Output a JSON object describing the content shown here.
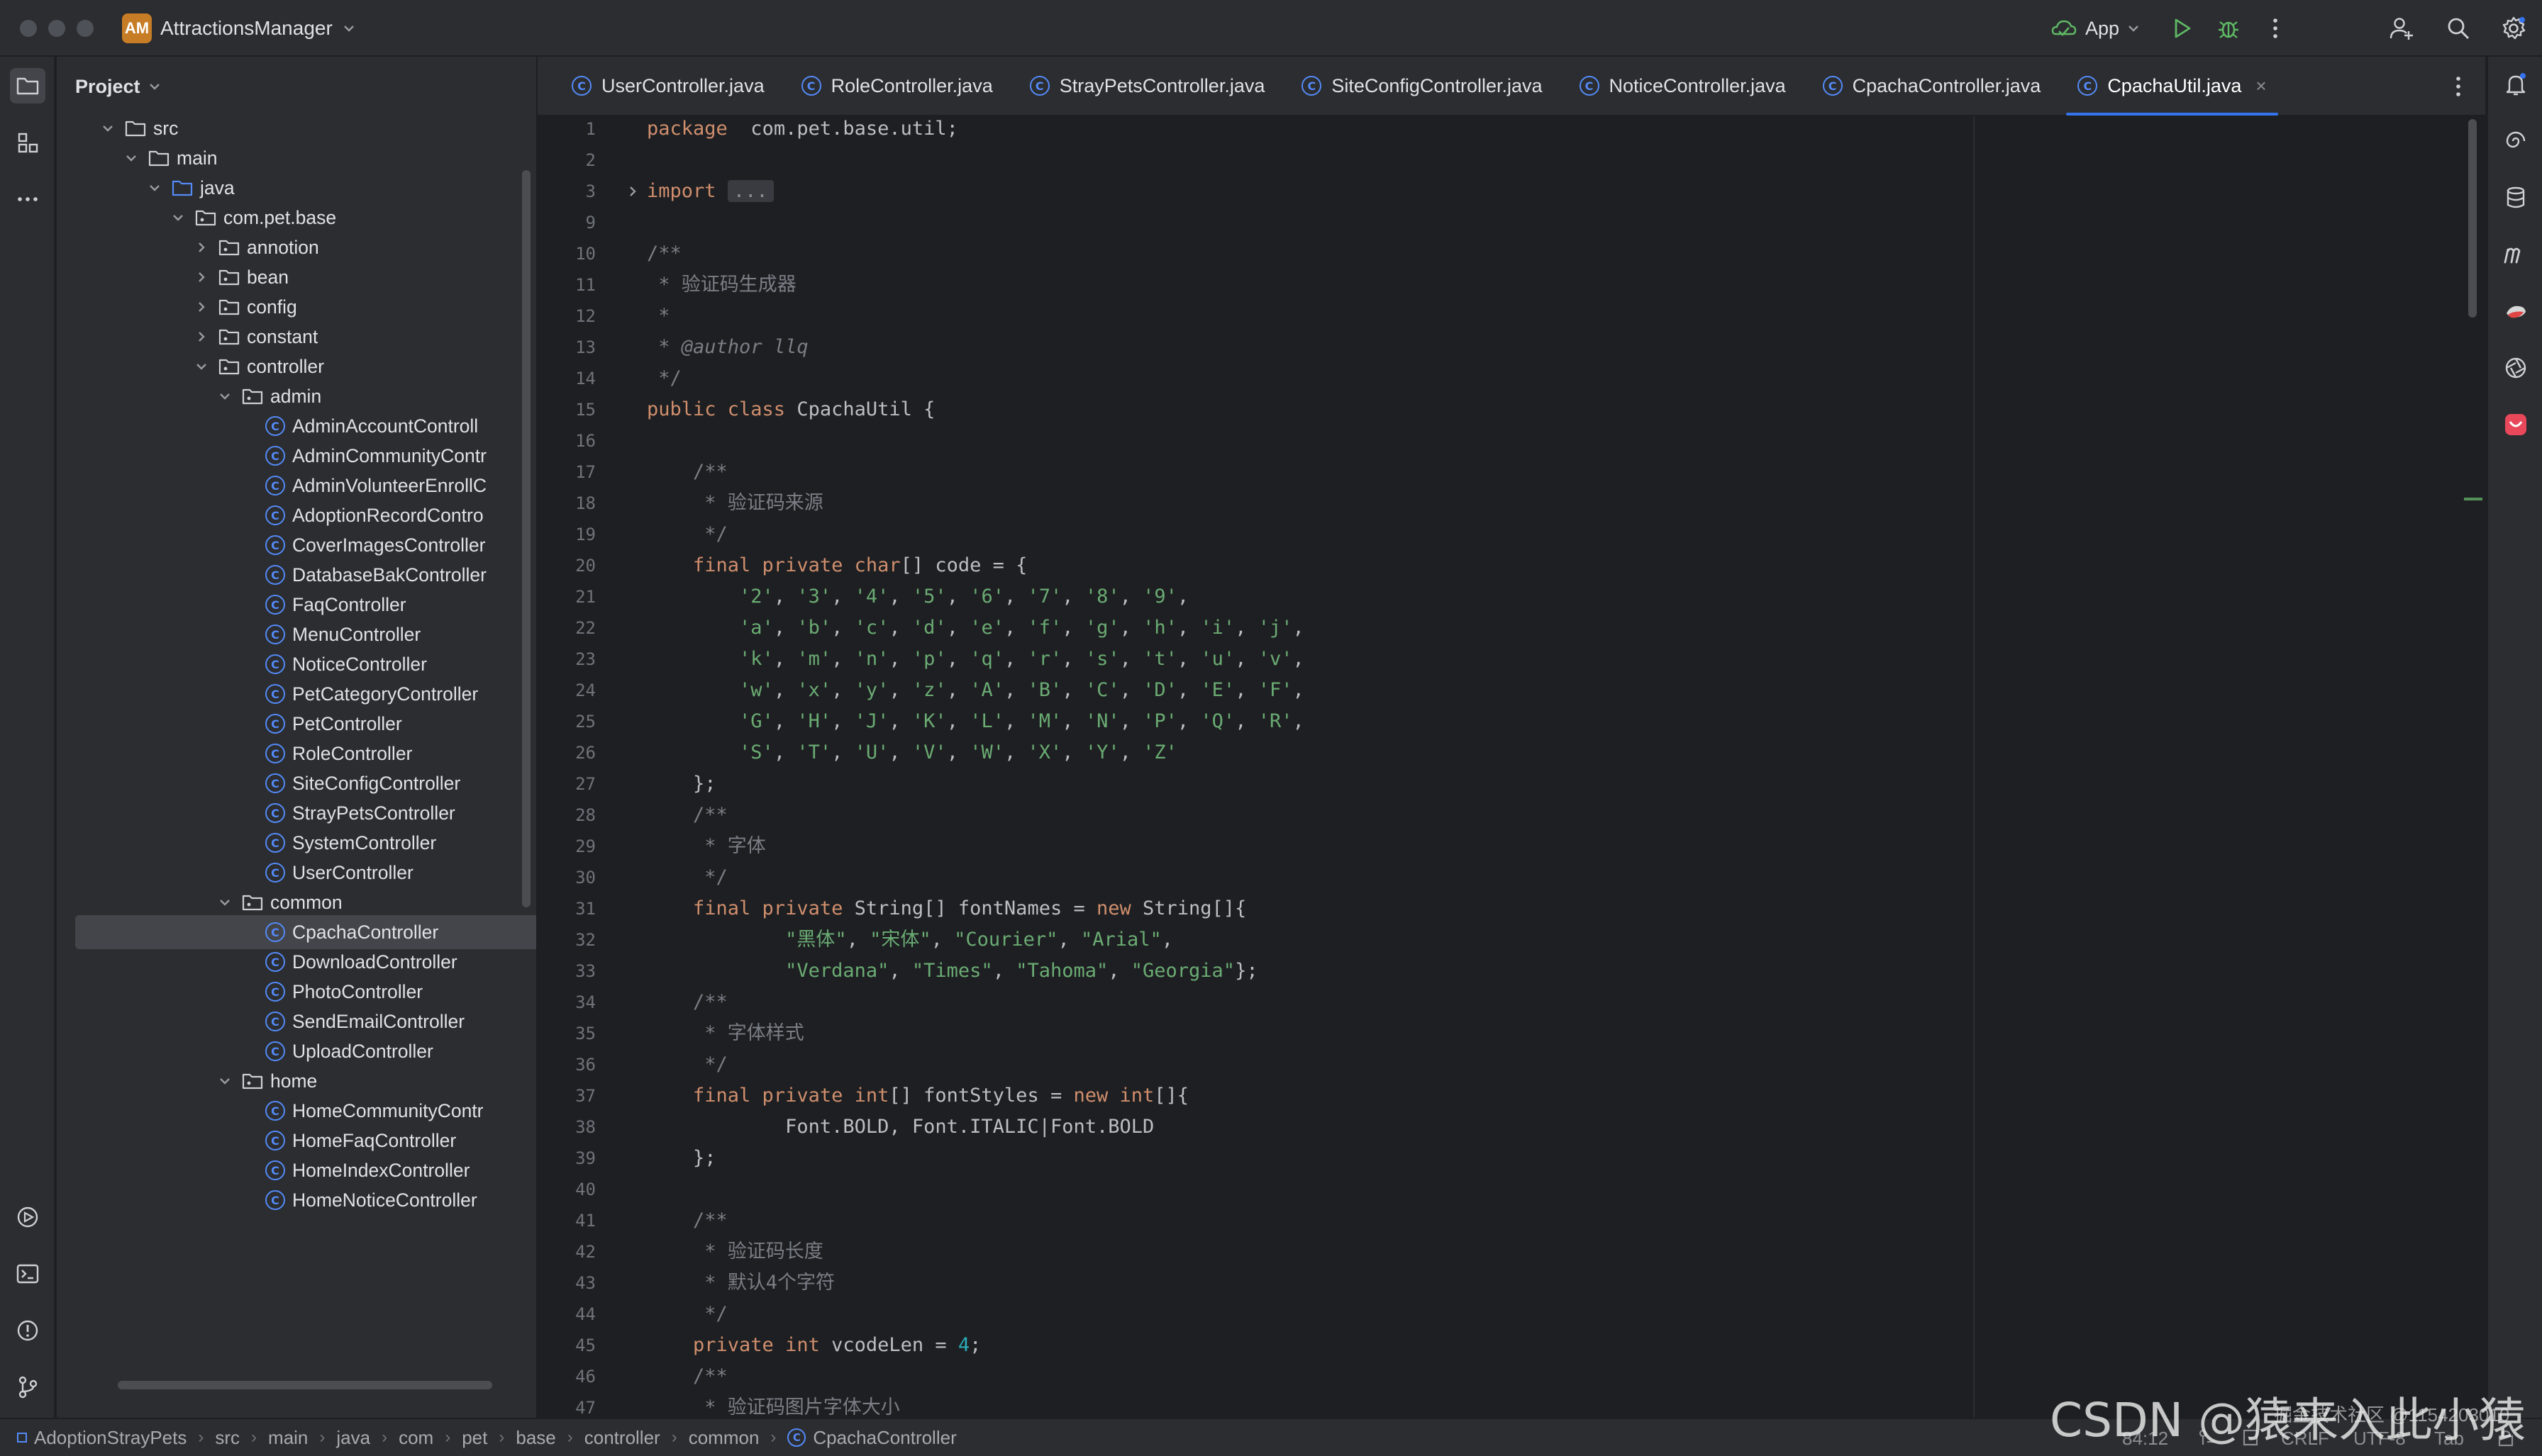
{
  "window": {
    "project_badge": "AM",
    "project_name": "AttractionsManager",
    "run_config": "App"
  },
  "colors": {
    "accent": "#3574f0",
    "keyword": "#cf8e6d",
    "string": "#6aab73",
    "number": "#2aacb8",
    "comment": "#7a7e85",
    "class_icon": "#548af7"
  },
  "project_panel": {
    "title": "Project",
    "tree": [
      {
        "label": "src",
        "kind": "folder",
        "depth": 0,
        "expanded": true
      },
      {
        "label": "main",
        "kind": "folder",
        "depth": 1,
        "expanded": true
      },
      {
        "label": "java",
        "kind": "source-folder",
        "depth": 2,
        "expanded": true
      },
      {
        "label": "com.pet.base",
        "kind": "package",
        "depth": 3,
        "expanded": true
      },
      {
        "label": "annotion",
        "kind": "package",
        "depth": 4,
        "expanded": false
      },
      {
        "label": "bean",
        "kind": "package",
        "depth": 4,
        "expanded": false
      },
      {
        "label": "config",
        "kind": "package",
        "depth": 4,
        "expanded": false
      },
      {
        "label": "constant",
        "kind": "package",
        "depth": 4,
        "expanded": false
      },
      {
        "label": "controller",
        "kind": "package",
        "depth": 4,
        "expanded": true
      },
      {
        "label": "admin",
        "kind": "package",
        "depth": 5,
        "expanded": true
      },
      {
        "label": "AdminAccountControll",
        "kind": "class",
        "depth": 6
      },
      {
        "label": "AdminCommunityContr",
        "kind": "class",
        "depth": 6
      },
      {
        "label": "AdminVolunteerEnrollC",
        "kind": "class",
        "depth": 6
      },
      {
        "label": "AdoptionRecordContro",
        "kind": "class",
        "depth": 6
      },
      {
        "label": "CoverImagesController",
        "kind": "class",
        "depth": 6
      },
      {
        "label": "DatabaseBakController",
        "kind": "class",
        "depth": 6
      },
      {
        "label": "FaqController",
        "kind": "class",
        "depth": 6
      },
      {
        "label": "MenuController",
        "kind": "class",
        "depth": 6
      },
      {
        "label": "NoticeController",
        "kind": "class",
        "depth": 6
      },
      {
        "label": "PetCategoryController",
        "kind": "class",
        "depth": 6
      },
      {
        "label": "PetController",
        "kind": "class",
        "depth": 6
      },
      {
        "label": "RoleController",
        "kind": "class",
        "depth": 6
      },
      {
        "label": "SiteConfigController",
        "kind": "class",
        "depth": 6
      },
      {
        "label": "StrayPetsController",
        "kind": "class",
        "depth": 6
      },
      {
        "label": "SystemController",
        "kind": "class",
        "depth": 6
      },
      {
        "label": "UserController",
        "kind": "class",
        "depth": 6
      },
      {
        "label": "common",
        "kind": "package",
        "depth": 5,
        "expanded": true
      },
      {
        "label": "CpachaController",
        "kind": "class",
        "depth": 6,
        "selected": true
      },
      {
        "label": "DownloadController",
        "kind": "class",
        "depth": 6
      },
      {
        "label": "PhotoController",
        "kind": "class",
        "depth": 6
      },
      {
        "label": "SendEmailController",
        "kind": "class",
        "depth": 6
      },
      {
        "label": "UploadController",
        "kind": "class",
        "depth": 6
      },
      {
        "label": "home",
        "kind": "package",
        "depth": 5,
        "expanded": true
      },
      {
        "label": "HomeCommunityContr",
        "kind": "class",
        "depth": 6
      },
      {
        "label": "HomeFaqController",
        "kind": "class",
        "depth": 6
      },
      {
        "label": "HomeIndexController",
        "kind": "class",
        "depth": 6
      },
      {
        "label": "HomeNoticeController",
        "kind": "class",
        "depth": 6
      }
    ]
  },
  "tabs": [
    {
      "label": "UserController.java",
      "active": false
    },
    {
      "label": "RoleController.java",
      "active": false
    },
    {
      "label": "StrayPetsController.java",
      "active": false
    },
    {
      "label": "SiteConfigController.java",
      "active": false
    },
    {
      "label": "NoticeController.java",
      "active": false
    },
    {
      "label": "CpachaController.java",
      "active": false
    },
    {
      "label": "CpachaUtil.java",
      "active": true
    }
  ],
  "editor": {
    "file": "CpachaUtil.java",
    "lines": [
      {
        "n": "1",
        "seg": [
          [
            "kw",
            "package"
          ],
          [
            "",
            "  com.pet.base.util;"
          ]
        ]
      },
      {
        "n": "2",
        "seg": []
      },
      {
        "n": "3",
        "seg": [
          [
            "kw",
            "import"
          ],
          [
            "",
            " "
          ],
          [
            "fold",
            "..."
          ]
        ]
      },
      {
        "n": "9",
        "seg": []
      },
      {
        "n": "10",
        "seg": [
          [
            "cmt",
            "/**"
          ]
        ]
      },
      {
        "n": "11",
        "seg": [
          [
            "cmt",
            " * 验证码生成器"
          ]
        ]
      },
      {
        "n": "12",
        "seg": [
          [
            "cmt",
            " *"
          ]
        ]
      },
      {
        "n": "13",
        "seg": [
          [
            "cmt",
            " * "
          ],
          [
            "ann",
            "@author llq"
          ]
        ]
      },
      {
        "n": "14",
        "seg": [
          [
            "cmt",
            " */"
          ]
        ]
      },
      {
        "n": "15",
        "seg": [
          [
            "kw",
            "public class "
          ],
          [
            "",
            "CpachaUtil {"
          ]
        ]
      },
      {
        "n": "16",
        "seg": []
      },
      {
        "n": "17",
        "seg": [
          [
            "cmt",
            "    /**"
          ]
        ]
      },
      {
        "n": "18",
        "seg": [
          [
            "cmt",
            "     * 验证码来源"
          ]
        ]
      },
      {
        "n": "19",
        "seg": [
          [
            "cmt",
            "     */"
          ]
        ]
      },
      {
        "n": "20",
        "seg": [
          [
            "kw",
            "    final private char"
          ],
          [
            "",
            "[] code = {"
          ]
        ]
      },
      {
        "n": "21",
        "seg": [
          [
            "str",
            "        '2'"
          ],
          [
            "",
            ", "
          ],
          [
            "str",
            "'3'"
          ],
          [
            "",
            ", "
          ],
          [
            "str",
            "'4'"
          ],
          [
            "",
            ", "
          ],
          [
            "str",
            "'5'"
          ],
          [
            "",
            ", "
          ],
          [
            "str",
            "'6'"
          ],
          [
            "",
            ", "
          ],
          [
            "str",
            "'7'"
          ],
          [
            "",
            ", "
          ],
          [
            "str",
            "'8'"
          ],
          [
            "",
            ", "
          ],
          [
            "str",
            "'9'"
          ],
          [
            "",
            ","
          ]
        ]
      },
      {
        "n": "22",
        "seg": [
          [
            "str",
            "        'a'"
          ],
          [
            "",
            ", "
          ],
          [
            "str",
            "'b'"
          ],
          [
            "",
            ", "
          ],
          [
            "str",
            "'c'"
          ],
          [
            "",
            ", "
          ],
          [
            "str",
            "'d'"
          ],
          [
            "",
            ", "
          ],
          [
            "str",
            "'e'"
          ],
          [
            "",
            ", "
          ],
          [
            "str",
            "'f'"
          ],
          [
            "",
            ", "
          ],
          [
            "str",
            "'g'"
          ],
          [
            "",
            ", "
          ],
          [
            "str",
            "'h'"
          ],
          [
            "",
            ", "
          ],
          [
            "str",
            "'i'"
          ],
          [
            "",
            ", "
          ],
          [
            "str",
            "'j'"
          ],
          [
            "",
            ","
          ]
        ]
      },
      {
        "n": "23",
        "seg": [
          [
            "str",
            "        'k'"
          ],
          [
            "",
            ", "
          ],
          [
            "str",
            "'m'"
          ],
          [
            "",
            ", "
          ],
          [
            "str",
            "'n'"
          ],
          [
            "",
            ", "
          ],
          [
            "str",
            "'p'"
          ],
          [
            "",
            ", "
          ],
          [
            "str",
            "'q'"
          ],
          [
            "",
            ", "
          ],
          [
            "str",
            "'r'"
          ],
          [
            "",
            ", "
          ],
          [
            "str",
            "'s'"
          ],
          [
            "",
            ", "
          ],
          [
            "str",
            "'t'"
          ],
          [
            "",
            ", "
          ],
          [
            "str",
            "'u'"
          ],
          [
            "",
            ", "
          ],
          [
            "str",
            "'v'"
          ],
          [
            "",
            ","
          ]
        ]
      },
      {
        "n": "24",
        "seg": [
          [
            "str",
            "        'w'"
          ],
          [
            "",
            ", "
          ],
          [
            "str",
            "'x'"
          ],
          [
            "",
            ", "
          ],
          [
            "str",
            "'y'"
          ],
          [
            "",
            ", "
          ],
          [
            "str",
            "'z'"
          ],
          [
            "",
            ", "
          ],
          [
            "str",
            "'A'"
          ],
          [
            "",
            ", "
          ],
          [
            "str",
            "'B'"
          ],
          [
            "",
            ", "
          ],
          [
            "str",
            "'C'"
          ],
          [
            "",
            ", "
          ],
          [
            "str",
            "'D'"
          ],
          [
            "",
            ", "
          ],
          [
            "str",
            "'E'"
          ],
          [
            "",
            ", "
          ],
          [
            "str",
            "'F'"
          ],
          [
            "",
            ","
          ]
        ]
      },
      {
        "n": "25",
        "seg": [
          [
            "str",
            "        'G'"
          ],
          [
            "",
            ", "
          ],
          [
            "str",
            "'H'"
          ],
          [
            "",
            ", "
          ],
          [
            "str",
            "'J'"
          ],
          [
            "",
            ", "
          ],
          [
            "str",
            "'K'"
          ],
          [
            "",
            ", "
          ],
          [
            "str",
            "'L'"
          ],
          [
            "",
            ", "
          ],
          [
            "str",
            "'M'"
          ],
          [
            "",
            ", "
          ],
          [
            "str",
            "'N'"
          ],
          [
            "",
            ", "
          ],
          [
            "str",
            "'P'"
          ],
          [
            "",
            ", "
          ],
          [
            "str",
            "'Q'"
          ],
          [
            "",
            ", "
          ],
          [
            "str",
            "'R'"
          ],
          [
            "",
            ","
          ]
        ]
      },
      {
        "n": "26",
        "seg": [
          [
            "str",
            "        'S'"
          ],
          [
            "",
            ", "
          ],
          [
            "str",
            "'T'"
          ],
          [
            "",
            ", "
          ],
          [
            "str",
            "'U'"
          ],
          [
            "",
            ", "
          ],
          [
            "str",
            "'V'"
          ],
          [
            "",
            ", "
          ],
          [
            "str",
            "'W'"
          ],
          [
            "",
            ", "
          ],
          [
            "str",
            "'X'"
          ],
          [
            "",
            ", "
          ],
          [
            "str",
            "'Y'"
          ],
          [
            "",
            ", "
          ],
          [
            "str",
            "'Z'"
          ]
        ]
      },
      {
        "n": "27",
        "seg": [
          [
            "",
            "    };"
          ]
        ]
      },
      {
        "n": "28",
        "seg": [
          [
            "cmt",
            "    /**"
          ]
        ]
      },
      {
        "n": "29",
        "seg": [
          [
            "cmt",
            "     * 字体"
          ]
        ]
      },
      {
        "n": "30",
        "seg": [
          [
            "cmt",
            "     */"
          ]
        ]
      },
      {
        "n": "31",
        "seg": [
          [
            "kw",
            "    final private "
          ],
          [
            "",
            "String[] fontNames = "
          ],
          [
            "kw",
            "new "
          ],
          [
            "",
            "String[]{"
          ]
        ]
      },
      {
        "n": "32",
        "seg": [
          [
            "str",
            "            \"黑体\""
          ],
          [
            "",
            ", "
          ],
          [
            "str",
            "\"宋体\""
          ],
          [
            "",
            ", "
          ],
          [
            "str",
            "\"Courier\""
          ],
          [
            "",
            ", "
          ],
          [
            "str",
            "\"Arial\""
          ],
          [
            "",
            ","
          ]
        ]
      },
      {
        "n": "33",
        "seg": [
          [
            "str",
            "            \"Verdana\""
          ],
          [
            "",
            ", "
          ],
          [
            "str",
            "\"Times\""
          ],
          [
            "",
            ", "
          ],
          [
            "str",
            "\"Tahoma\""
          ],
          [
            "",
            ", "
          ],
          [
            "str",
            "\"Georgia\""
          ],
          [
            "",
            "};"
          ]
        ]
      },
      {
        "n": "34",
        "seg": [
          [
            "cmt",
            "    /**"
          ]
        ]
      },
      {
        "n": "35",
        "seg": [
          [
            "cmt",
            "     * 字体样式"
          ]
        ]
      },
      {
        "n": "36",
        "seg": [
          [
            "cmt",
            "     */"
          ]
        ]
      },
      {
        "n": "37",
        "seg": [
          [
            "kw",
            "    final private int"
          ],
          [
            "",
            "[] fontStyles = "
          ],
          [
            "kw",
            "new int"
          ],
          [
            "",
            "[]{"
          ]
        ]
      },
      {
        "n": "38",
        "seg": [
          [
            "",
            "            Font.BOLD, Font.ITALIC|Font.BOLD"
          ]
        ]
      },
      {
        "n": "39",
        "seg": [
          [
            "",
            "    };"
          ]
        ]
      },
      {
        "n": "40",
        "seg": []
      },
      {
        "n": "41",
        "seg": [
          [
            "cmt",
            "    /**"
          ]
        ]
      },
      {
        "n": "42",
        "seg": [
          [
            "cmt",
            "     * 验证码长度"
          ]
        ]
      },
      {
        "n": "43",
        "seg": [
          [
            "cmt",
            "     * 默认4个字符"
          ]
        ]
      },
      {
        "n": "44",
        "seg": [
          [
            "cmt",
            "     */"
          ]
        ]
      },
      {
        "n": "45",
        "seg": [
          [
            "kw",
            "    private int "
          ],
          [
            "",
            "vcodeLen = "
          ],
          [
            "num",
            "4"
          ],
          [
            "",
            ";"
          ]
        ]
      },
      {
        "n": "46",
        "seg": [
          [
            "cmt",
            "    /**"
          ]
        ]
      },
      {
        "n": "47",
        "seg": [
          [
            "cmt",
            "     * 验证码图片字体大小"
          ]
        ]
      }
    ]
  },
  "statusbar": {
    "breadcrumbs": [
      "AdoptionStrayPets",
      "src",
      "main",
      "java",
      "com",
      "pet",
      "base",
      "controller",
      "common",
      "CpachaController"
    ],
    "caret": "84:12",
    "line_sep": "CRLF",
    "encoding": "UTF-8",
    "indent": "Tab",
    "watermark": "CSDN @猿来入此小猿",
    "watermark_small": "掘金技术社区 @1154203010"
  }
}
